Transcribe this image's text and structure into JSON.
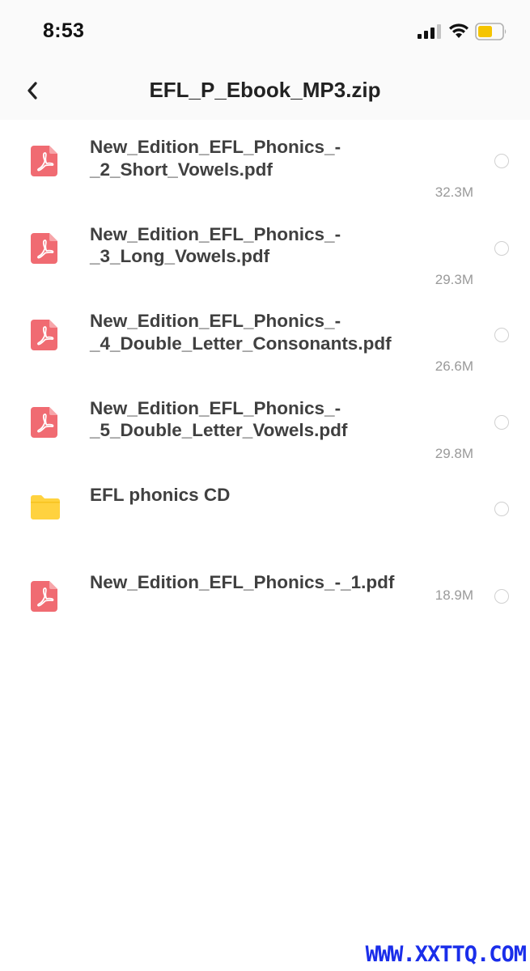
{
  "status_bar": {
    "time": "8:53",
    "battery_color": "#f5c400",
    "icons": [
      "signal-icon",
      "wifi-icon",
      "battery-icon"
    ]
  },
  "nav": {
    "title": "EFL_P_Ebook_MP3.zip",
    "back_icon": "chevron-left-icon"
  },
  "files": [
    {
      "name": "New_Edition_EFL_Phonics_-_2_Short_Vowels.pdf",
      "line1": "New_Edition_EFL_Phonics_-",
      "line2": "_2_Short_Vowels.pdf",
      "size": "32.3M",
      "type": "pdf"
    },
    {
      "name": "New_Edition_EFL_Phonics_-_3_Long_Vowels.pdf",
      "line1": "New_Edition_EFL_Phonics_-",
      "line2": "_3_Long_Vowels.pdf",
      "size": "29.3M",
      "type": "pdf"
    },
    {
      "name": "New_Edition_EFL_Phonics_-_4_Double_Letter_Consonants.pdf",
      "line1": "New_Edition_EFL_Phonics_-",
      "line2": "_4_Double_Letter_Consonants.pdf",
      "size": "26.6M",
      "type": "pdf"
    },
    {
      "name": "New_Edition_EFL_Phonics_-_5_Double_Letter_Vowels.pdf",
      "line1": "New_Edition_EFL_Phonics_-",
      "line2": "_5_Double_Letter_Vowels.pdf",
      "size": "29.8M",
      "type": "pdf"
    },
    {
      "name": "EFL phonics CD",
      "line1": "EFL phonics CD",
      "line2": "",
      "size": "",
      "type": "folder"
    },
    {
      "name": "New_Edition_EFL_Phonics_-_1.pdf",
      "line1": "New_Edition_EFL_Phonics_-_1.pdf",
      "line2": "",
      "size": "18.9M",
      "type": "pdf"
    }
  ],
  "colors": {
    "pdf_icon": "#f06b72",
    "folder_icon": "#ffd23f",
    "watermark": "#1a2eea"
  },
  "watermark": "WWW.XXTTQ.COM"
}
